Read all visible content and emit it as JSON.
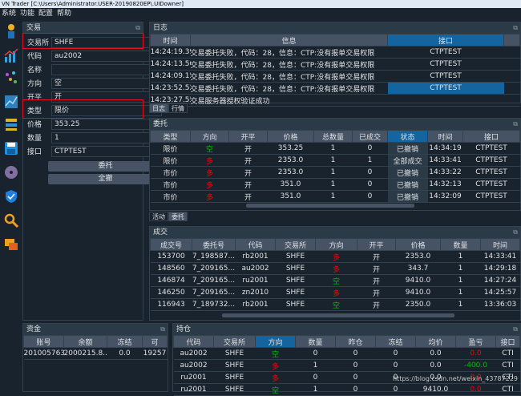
{
  "window": {
    "title": "VN Trader [C:\\Users\\Administrator.USER-20190820EP\\.UIDowner]"
  },
  "menu": [
    "系统",
    "功能",
    "配置",
    "帮助"
  ],
  "trade_panel": {
    "title": "交易",
    "exchange_label": "交易所",
    "exchange": "SHFE",
    "code_label": "代码",
    "code": "au2002",
    "name_label": "名称",
    "name": "",
    "direction_label": "方向",
    "direction": "空",
    "offset_label": "开平",
    "offset": "开",
    "type_label": "类型",
    "type": "限价",
    "price_label": "价格",
    "price": "353.25",
    "volume_label": "数量",
    "volume": "1",
    "gateway_label": "接口",
    "gateway": "CTPTEST",
    "send_btn": "委托",
    "cancel_all_btn": "全撤"
  },
  "log_panel": {
    "title": "日志",
    "headers": [
      "时间",
      "信息",
      "接口"
    ],
    "rows": [
      [
        "14:24:19.398",
        "交易委托失败，代码：28，信息：CTP:没有报单交易权限",
        "CTPTEST"
      ],
      [
        "14:24:13.505",
        "交易委托失败，代码：28，信息：CTP:没有报单交易权限",
        "CTPTEST"
      ],
      [
        "14:24:09.157",
        "交易委托失败，代码：28，信息：CTP:没有报单交易权限",
        "CTPTEST"
      ],
      [
        "14:23:52.528",
        "交易委托失败，代码：28，信息：CTP:没有报单交易权限",
        "CTPTEST"
      ],
      [
        "14:23:27.550",
        "交易服务器授权验证成功",
        ""
      ]
    ],
    "tabs": [
      "日志",
      "行情"
    ]
  },
  "order_panel": {
    "title": "委托",
    "headers": [
      "类型",
      "方向",
      "开平",
      "价格",
      "总数量",
      "已成交",
      "状态",
      "时间",
      "接口"
    ],
    "rows": [
      [
        "限价",
        "空",
        "开",
        "353.25",
        "1",
        "0",
        "已撤销",
        "14:34:19",
        "CTPTEST"
      ],
      [
        "限价",
        "多",
        "开",
        "2353.0",
        "1",
        "1",
        "全部成交",
        "14:33:41",
        "CTPTEST"
      ],
      [
        "市价",
        "多",
        "开",
        "2353.0",
        "1",
        "0",
        "已撤销",
        "14:33:22",
        "CTPTEST"
      ],
      [
        "市价",
        "多",
        "开",
        "351.0",
        "1",
        "0",
        "已撤销",
        "14:32:13",
        "CTPTEST"
      ],
      [
        "市价",
        "多",
        "开",
        "351.0",
        "1",
        "0",
        "已撤销",
        "14:32:09",
        "CTPTEST"
      ]
    ],
    "tabs": [
      "活动",
      "委托"
    ]
  },
  "trade_list": {
    "title": "成交",
    "headers": [
      "成交号",
      "委托号",
      "代码",
      "交易所",
      "方向",
      "开平",
      "价格",
      "数量",
      "时间"
    ],
    "rows": [
      [
        "153700",
        "7_198587...",
        "rb2001",
        "SHFE",
        "多",
        "开",
        "2353.0",
        "1",
        "14:33:41"
      ],
      [
        "148560",
        "7_209165...",
        "au2002",
        "SHFE",
        "多",
        "开",
        "343.7",
        "1",
        "14:29:18"
      ],
      [
        "146874",
        "7_209165...",
        "ru2001",
        "SHFE",
        "空",
        "开",
        "9410.0",
        "1",
        "14:27:24"
      ],
      [
        "146250",
        "7_209165...",
        "zn2010",
        "SHFE",
        "多",
        "开",
        "9410.0",
        "1",
        "14:25:57"
      ],
      [
        "116943",
        "7_189732...",
        "rb2001",
        "SHFE",
        "空",
        "开",
        "2350.0",
        "1",
        "13:36:03"
      ]
    ]
  },
  "account_panel": {
    "title": "资金",
    "headers": [
      "账号",
      "余额",
      "冻结",
      "可"
    ],
    "rows": [
      [
        "201005763",
        "2000215.8...",
        "0.0",
        "19257"
      ]
    ]
  },
  "position_panel": {
    "title": "持仓",
    "headers": [
      "代码",
      "交易所",
      "方向",
      "数量",
      "昨仓",
      "冻结",
      "均价",
      "盈亏",
      "接口"
    ],
    "rows": [
      [
        "au2002",
        "SHFE",
        "空",
        "0",
        "0",
        "0",
        "0.0",
        "0.0",
        "CTI"
      ],
      [
        "au2002",
        "SHFE",
        "多",
        "1",
        "0",
        "0",
        "0.0",
        "-400.0",
        "CTI"
      ],
      [
        "ru2001",
        "SHFE",
        "多",
        "0",
        "0",
        "0",
        "0.0",
        "0.0",
        "CTI"
      ],
      [
        "ru2001",
        "SHFE",
        "空",
        "1",
        "0",
        "0",
        "9410.0",
        "0.0",
        "CTI"
      ]
    ]
  },
  "watermark": "https://blog.csdn.net/weixin_43787229",
  "colors": {
    "bg": "#19232d",
    "header": "#455364",
    "selected": "#1464a0",
    "long": "#ff0000",
    "short": "#00c000",
    "highlight_box": "#e01020"
  }
}
